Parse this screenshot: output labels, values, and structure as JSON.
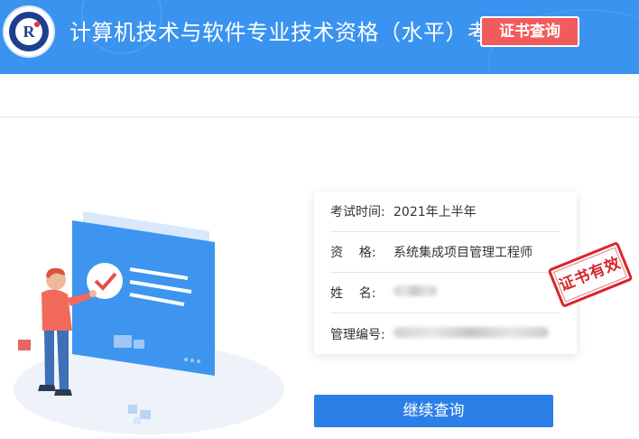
{
  "header": {
    "title": "计算机技术与软件专业技术资格（水平）考试",
    "cert_query_label": "证书查询",
    "logo_icon": "certification-emblem-icon"
  },
  "result": {
    "rows": [
      {
        "label": "考试时间:",
        "value": "2021年上半年"
      },
      {
        "label": "资    格:",
        "value": "系统集成项目管理工程师"
      },
      {
        "label": "姓    名:",
        "value": ""
      },
      {
        "label": "管理编号:",
        "value": ""
      }
    ],
    "stamp_text": "证书有效"
  },
  "actions": {
    "continue_label": "继续查询"
  },
  "colors": {
    "header_bg": "#3a93ef",
    "cert_button": "#f25b5b",
    "primary_button": "#2d7fe8",
    "stamp_red": "#d8262b"
  }
}
